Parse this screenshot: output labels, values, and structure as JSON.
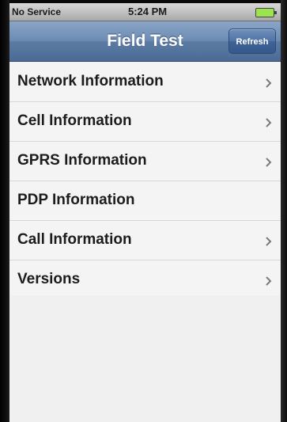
{
  "status_bar": {
    "carrier": "No Service",
    "time": "5:24 PM",
    "battery_icon": "battery-full-icon",
    "battery_color": "#9be34f"
  },
  "nav_bar": {
    "title": "Field Test",
    "refresh_label": "Refresh"
  },
  "menu": {
    "items": [
      {
        "label": "Network Information",
        "has_chevron": true
      },
      {
        "label": "Cell Information",
        "has_chevron": true
      },
      {
        "label": "GPRS Information",
        "has_chevron": true
      },
      {
        "label": "PDP Information",
        "has_chevron": false
      },
      {
        "label": "Call Information",
        "has_chevron": true
      },
      {
        "label": "Versions",
        "has_chevron": true
      }
    ]
  },
  "colors": {
    "nav_bar": "#6d8cb3",
    "refresh_button": "#4f73a5",
    "list_background": "#f4f4f4"
  }
}
